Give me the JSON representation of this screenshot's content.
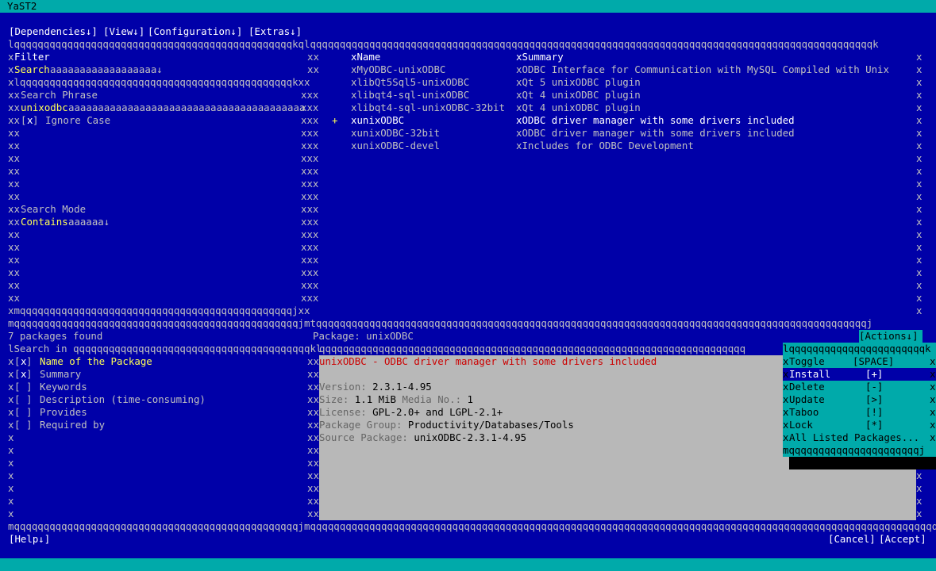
{
  "title": "YaST2",
  "menu": [
    "[Dependencies↓]",
    "[View↓]",
    "[Configuration↓]",
    "[Extras↓]"
  ],
  "frame": {
    "top": "lqqqqqqqqqqqqqqqqqqqqqqqqqqqqqqqqqqqqqqqqqqqqqqqkqlqqqqqqqqqqqqqqqqqqqqqqqqqqqqqqqqqqqqqqqqqqqqqqqqqqqqqqqqqqqqqqqqqqqqqqqqqqqqqqqqqqqqqqqqqqqqqqqk",
    "filter_inner_top": "xlqqqqqqqqqqqqqqqqqqqqqqqqqqqqqqqqqqqqqqqqqqqqqqkxx",
    "filter_inner_bottom": "xmqqqqqqqqqqqqqqqqqqqqqqqqqqqqqqqqqqqqqqqqqqqqqqjxx",
    "mid_bottom": "mqqqqqqqqqqqqqqqqqqqqqqqqqqqqqqqqqqqqqqqqqqqqqqqqjmtqqqqqqqqqqqqqqqqqqqqqqqqqqqqqqqqqqqqqqqqqqqqqqqqqqqqqqqqqqqqqqqqqqqqqqqqqqqqqqqqqqqqqqqqqqqqqj",
    "search_in_rule": "qqqqqqqqqqqqqqqqqqqqqqqqqqqqqqqqqqqqqqqqkl",
    "desc_rule": "qqqqqqqqqqqqqqqqqqqqqqqqqqqqqqqqqqqqqqqqqqqqqqqqqqqqqqqqqqqqqqqqqqqqqqqq",
    "bottom": "mqqqqqqqqqqqqqqqqqqqqqqqqqqqqqqqqqqqqqqqqqqqqqqqqjmqqqqqqqqqqqqqqqqqqqqqqqqqqqqqqqqqqqqqqqqqqqqqqqqqqqqqqqqqqqqqqqqqqqqqqqqqqqqqqqqqqqqqqqqqqqqqqqqqqqqqqqqqqj",
    "x": "x",
    "xx": "xx",
    "xxx": "xxx"
  },
  "filter": {
    "label": "Filter",
    "dropdown_value": "Search",
    "dropdown_fill": "aaaaaaaaaaaaaaaaaa↓",
    "phrase_label": "Search Phrase",
    "phrase_value": "unixodbc",
    "phrase_fill": "aaaaaaaaaaaaaaaaaaaaaaaaaaaaaaaaaaaaaaaa",
    "phrase_hotkey": "P",
    "ignore_case_box": "x",
    "ignore_case_label": "Ignore Case",
    "ignore_case_hotkey": "I",
    "mode_label": "Search Mode",
    "mode_value": "Contains",
    "mode_fill": "aaaaaa↓"
  },
  "packages": {
    "col_name": "Name",
    "col_summary": "Summary",
    "rows": [
      {
        "status": "",
        "name": "MyODBC-unixODBC",
        "summary": "ODBC Interface for Communication with MySQL Compiled with Unix",
        "selected": false
      },
      {
        "status": "",
        "name": "libQt5Sql5-unixODBC",
        "summary": "Qt 5 unixODBC plugin",
        "selected": false
      },
      {
        "status": "",
        "name": "libqt4-sql-unixODBC",
        "summary": "Qt 4 unixODBC plugin",
        "selected": false
      },
      {
        "status": "",
        "name": "libqt4-sql-unixODBC-32bit",
        "summary": "Qt 4 unixODBC plugin",
        "selected": false
      },
      {
        "status": "+",
        "name": "unixODBC",
        "summary": "ODBC driver manager with some drivers included",
        "selected": true
      },
      {
        "status": "",
        "name": "unixODBC-32bit",
        "summary": "ODBC driver manager with some drivers included",
        "selected": false
      },
      {
        "status": "",
        "name": "unixODBC-devel",
        "summary": "Includes for ODBC Development",
        "selected": false
      }
    ]
  },
  "status": {
    "found": "7 packages found",
    "package_label": "Package: unixODBC"
  },
  "search_in": {
    "label": "Search in",
    "options": [
      {
        "checked": "x",
        "label": "Name of the Package",
        "highlight": true
      },
      {
        "checked": "x",
        "label": "Summary",
        "highlight": false
      },
      {
        "checked": " ",
        "label": "Keywords",
        "highlight": false
      },
      {
        "checked": " ",
        "label": "Description (time-consuming)",
        "highlight": false
      },
      {
        "checked": " ",
        "label": "Provides",
        "highlight": false
      },
      {
        "checked": " ",
        "label": "Required by",
        "highlight": false
      }
    ]
  },
  "description": {
    "headline": "unixODBC - ODBC driver manager with some drivers included",
    "version_label": "Version:",
    "version_value": "2.3.1-4.95",
    "size_label": "Size:",
    "size_value": "1.1 MiB",
    "media_label": "Media No.:",
    "media_value": "1",
    "license_label": "License:",
    "license_value": "GPL-2.0+ and LGPL-2.1+",
    "group_label": "Package Group:",
    "group_value": "Productivity/Databases/Tools",
    "source_label": "Source Package:",
    "source_value": "unixODBC-2.3.1-4.95"
  },
  "actions": {
    "button_label": "[Actions↓]",
    "top_rule": "lqqqqqqqqqqqqqqqqqqqqqqqk",
    "bottom_rule": "mqqqqqqqqqqqqqqqqqqqqqqj",
    "items": [
      {
        "label": "Toggle",
        "key": "[SPACE]",
        "active": false
      },
      {
        "label": "Install",
        "key": "[+]",
        "active": true
      },
      {
        "label": "Delete",
        "key": "[-]",
        "active": false
      },
      {
        "label": "Update",
        "key": "[>]",
        "active": false
      },
      {
        "label": "Taboo",
        "key": "[!]",
        "active": false
      },
      {
        "label": "Lock",
        "key": "[*]",
        "active": false
      },
      {
        "label": "All Listed Packages...",
        "key": "",
        "active": false
      }
    ]
  },
  "footer": {
    "help": "[Help↓]",
    "cancel": "[Cancel]",
    "accept": "[Accept]"
  }
}
